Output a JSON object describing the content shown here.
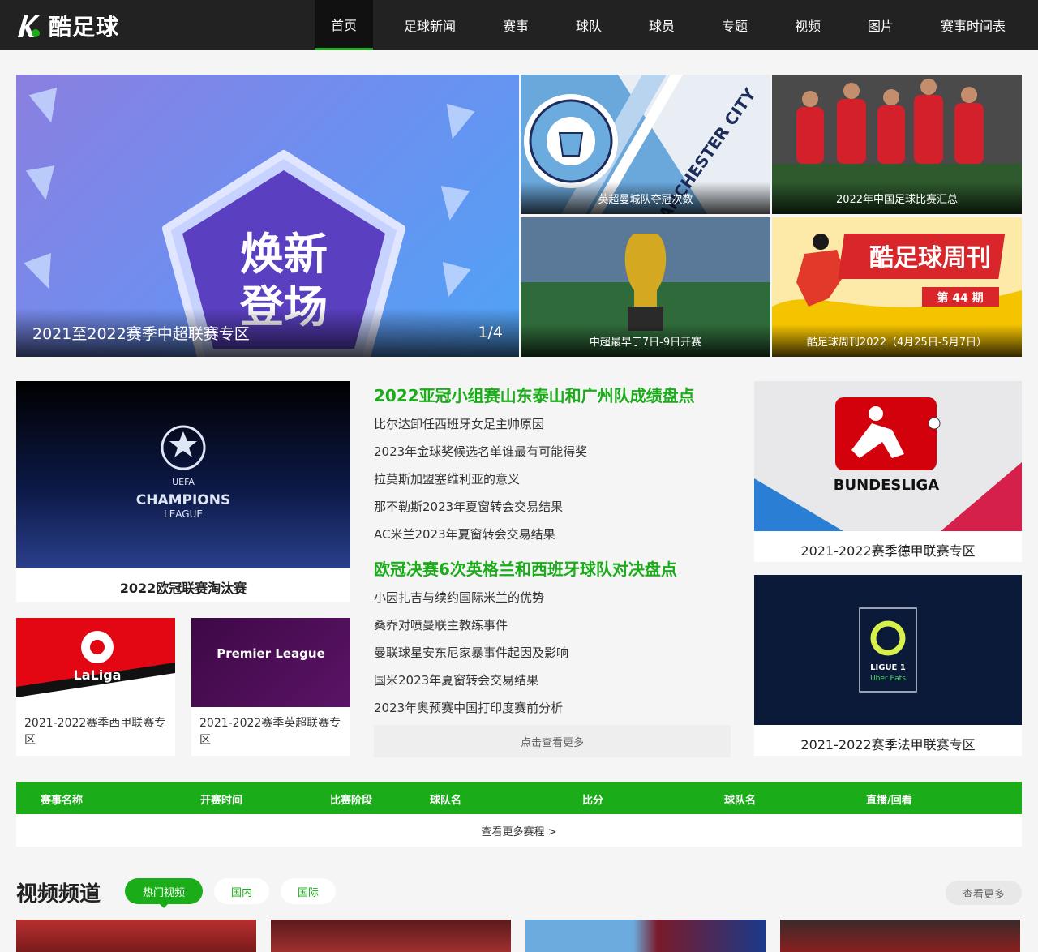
{
  "brand": {
    "name": "酷足球",
    "accent": "#1aad19"
  },
  "nav": [
    {
      "label": "首页",
      "active": true
    },
    {
      "label": "足球新闻"
    },
    {
      "label": "赛事"
    },
    {
      "label": "球队"
    },
    {
      "label": "球员"
    },
    {
      "label": "专题"
    },
    {
      "label": "视频"
    },
    {
      "label": "图片"
    },
    {
      "label": "赛事时间表"
    }
  ],
  "hero": {
    "main_caption": "2021至2022赛季中超联赛专区",
    "pager": "1/4",
    "main_art_line1": "焕新",
    "main_art_line2": "登场",
    "tiles": [
      {
        "caption": "英超曼城队夺冠次数",
        "art": "MANCHESTER CITY"
      },
      {
        "caption": "2022年中国足球比赛汇总"
      },
      {
        "caption": "中超最早于7日-9日开赛"
      },
      {
        "caption": "酷足球周刊2022（4月25日-5月7日）",
        "art": "酷足球周刊",
        "art_sub": "第 44 期"
      }
    ]
  },
  "cards": {
    "ucl": {
      "label": "2022欧冠联赛淘汰赛",
      "art1": "UEFA",
      "art2": "CHAMPIONS",
      "art3": "LEAGUE"
    },
    "laliga": {
      "label": "2021-2022赛季西甲联赛专区",
      "art": "LaLiga"
    },
    "epl": {
      "label": "2021-2022赛季英超联赛专区",
      "art": "Premier League"
    },
    "bundes": {
      "label": "2021-2022赛季德甲联赛专区",
      "art": "BUNDESLIGA"
    },
    "ligue1": {
      "label": "2021-2022赛季法甲联赛专区",
      "art1": "LIGUE 1",
      "art2": "Uber Eats"
    }
  },
  "news": {
    "groups": [
      {
        "headline": "2022亚冠小组赛山东泰山和广州队成绩盘点",
        "items": [
          "比尔达卸任西班牙女足主帅原因",
          "2023年金球奖候选名单谁最有可能得奖",
          "拉莫斯加盟塞维利亚的意义",
          "那不勒斯2023年夏窗转会交易结果",
          "AC米兰2023年夏窗转会交易结果"
        ]
      },
      {
        "headline": "欧冠决赛6次英格兰和西班牙球队对决盘点",
        "items": [
          "小因扎吉与续约国际米兰的优势",
          "桑乔对喷曼联主教练事件",
          "曼联球星安东尼家暴事件起因及影响",
          "国米2023年夏窗转会交易结果",
          "2023年奥预赛中国打印度赛前分析"
        ]
      }
    ],
    "more": "点击查看更多"
  },
  "schedule": {
    "columns": [
      "赛事名称",
      "开赛时间",
      "比赛阶段",
      "球队名",
      "比分",
      "球队名",
      "直播/回看"
    ],
    "more": "查看更多赛程 >"
  },
  "video": {
    "title": "视频频道",
    "tabs": [
      "热门视频",
      "国内",
      "国际"
    ],
    "more": "查看更多"
  }
}
